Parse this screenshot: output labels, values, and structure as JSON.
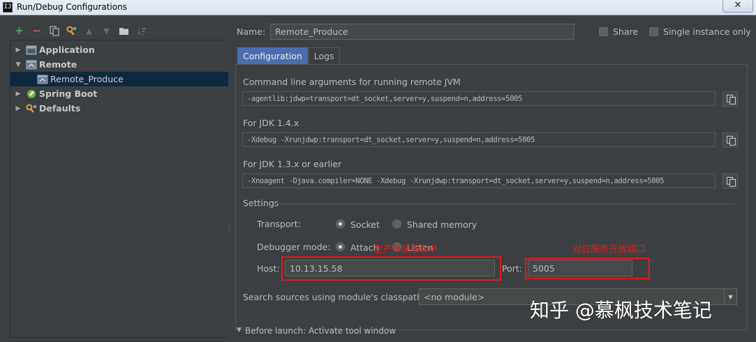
{
  "window": {
    "title": "Run/Debug Configurations",
    "close": "✕"
  },
  "toolbar": {
    "add": "+",
    "remove": "−"
  },
  "tree": [
    {
      "label": "Application",
      "expand": "▶"
    },
    {
      "label": "Remote",
      "expand": "▼"
    },
    {
      "label": "Remote_Produce"
    },
    {
      "label": "Spring Boot",
      "expand": "▶"
    },
    {
      "label": "Defaults",
      "expand": "▶"
    }
  ],
  "name": {
    "label": "Name:",
    "value": "Remote_Produce"
  },
  "share": {
    "label": "Share"
  },
  "single_instance": {
    "label": "Single instance only"
  },
  "tabs": [
    {
      "label": "Configuration"
    },
    {
      "label": "Logs"
    }
  ],
  "cmdline": {
    "label": "Command line arguments for running remote JVM",
    "value": "-agentlib:jdwp=transport=dt_socket,server=y,suspend=n,address=5005"
  },
  "jdk14": {
    "label": "For JDK 1.4.x",
    "value": "-Xdebug -Xrunjdwp:transport=dt_socket,server=y,suspend=n,address=5005"
  },
  "jdk13": {
    "label": "For JDK 1.3.x or earlier",
    "value": "-Xnoagent -Djava.compiler=NONE -Xdebug -Xrunjdwp:transport=dt_socket,server=y,suspend=n,address=5005"
  },
  "settings": {
    "label": "Settings",
    "transport": {
      "label": "Transport:",
      "options": [
        "Socket",
        "Shared memory"
      ],
      "selected": "Socket"
    },
    "debugger_mode": {
      "label": "Debugger mode:",
      "options": [
        "Attach",
        "Listen"
      ],
      "selected": "Attach"
    },
    "host": {
      "label": "Host:",
      "value": "10.13.15.58"
    },
    "port": {
      "label": "Port:",
      "value": "5005"
    }
  },
  "classpath": {
    "label": "Search sources using module's classpath:",
    "value": "<no module>"
  },
  "before_launch": {
    "label": "Before launch: Activate tool window"
  },
  "annotations": {
    "host_note": "生产环境服务IP",
    "port_note": "对应服务开放端口"
  },
  "watermark": "知乎 @慕枫技术笔记",
  "colors": {
    "background": "#3c3f41",
    "selection": "#0d293e",
    "active_tab": "#4b6eaf",
    "annotation": "#e21b1b",
    "add": "#59a869",
    "remove": "#e05555"
  }
}
